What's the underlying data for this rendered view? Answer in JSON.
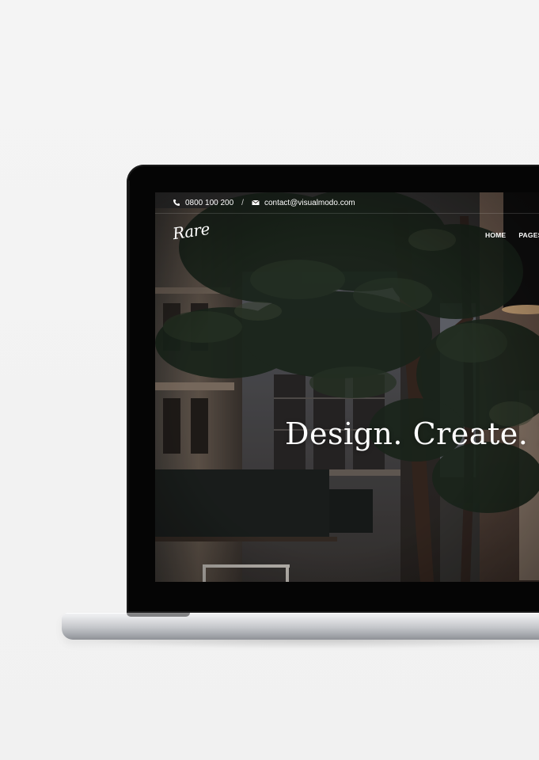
{
  "site": {
    "topbar": {
      "phone": "0800 100 200",
      "separator": "/",
      "email": "contact@visualmodo.com",
      "phone_icon": "phone-icon",
      "email_icon": "envelope-icon"
    },
    "logo_text": "Rare",
    "nav": {
      "home": "HOME",
      "pages": "PAGES"
    },
    "hero": {
      "headline": "Design. Create. In"
    }
  },
  "colors": {
    "page_background": "#f2f2f2",
    "text_on_dark": "#ffffff",
    "bezel": "#050505"
  }
}
